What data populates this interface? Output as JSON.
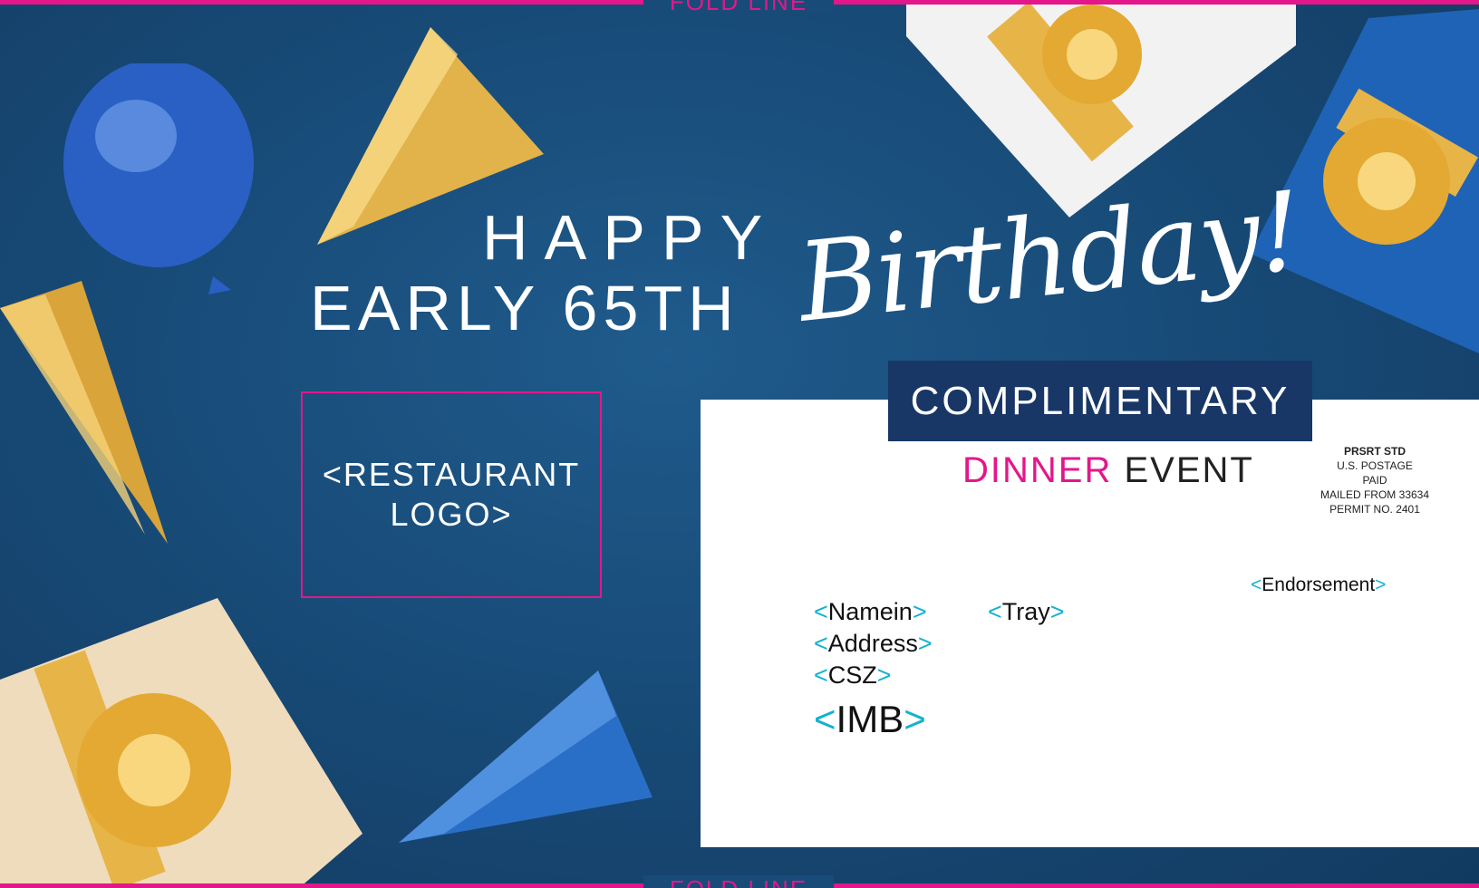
{
  "fold_line": {
    "top_label": "FOLD LINE",
    "bottom_label": "FOLD LINE"
  },
  "headline": {
    "line1": "HAPPY",
    "line2": "EARLY 65TH",
    "script": "Birthday!"
  },
  "logo_placeholder": {
    "line1": "<RESTAURANT",
    "line2": "LOGO>"
  },
  "banner": {
    "label": "COMPLIMENTARY"
  },
  "event": {
    "word1": "DINNER",
    "word2": "EVENT"
  },
  "postage": {
    "line1": "PRSRT STD",
    "line2": "U.S. POSTAGE",
    "line3": "PAID",
    "line4": "MAILED FROM 33634",
    "line5": "PERMIT NO. 2401"
  },
  "address": {
    "namein": "Namein",
    "tray": "Tray",
    "address": "Address",
    "csz": "CSZ",
    "imb": "IMB",
    "endorsement": "Endorsement",
    "open_bracket": "<",
    "close_bracket": ">"
  },
  "colors": {
    "accent_pink": "#e3178a",
    "accent_cyan": "#12b2cf",
    "navy": "#183766",
    "background": "#184b78"
  }
}
